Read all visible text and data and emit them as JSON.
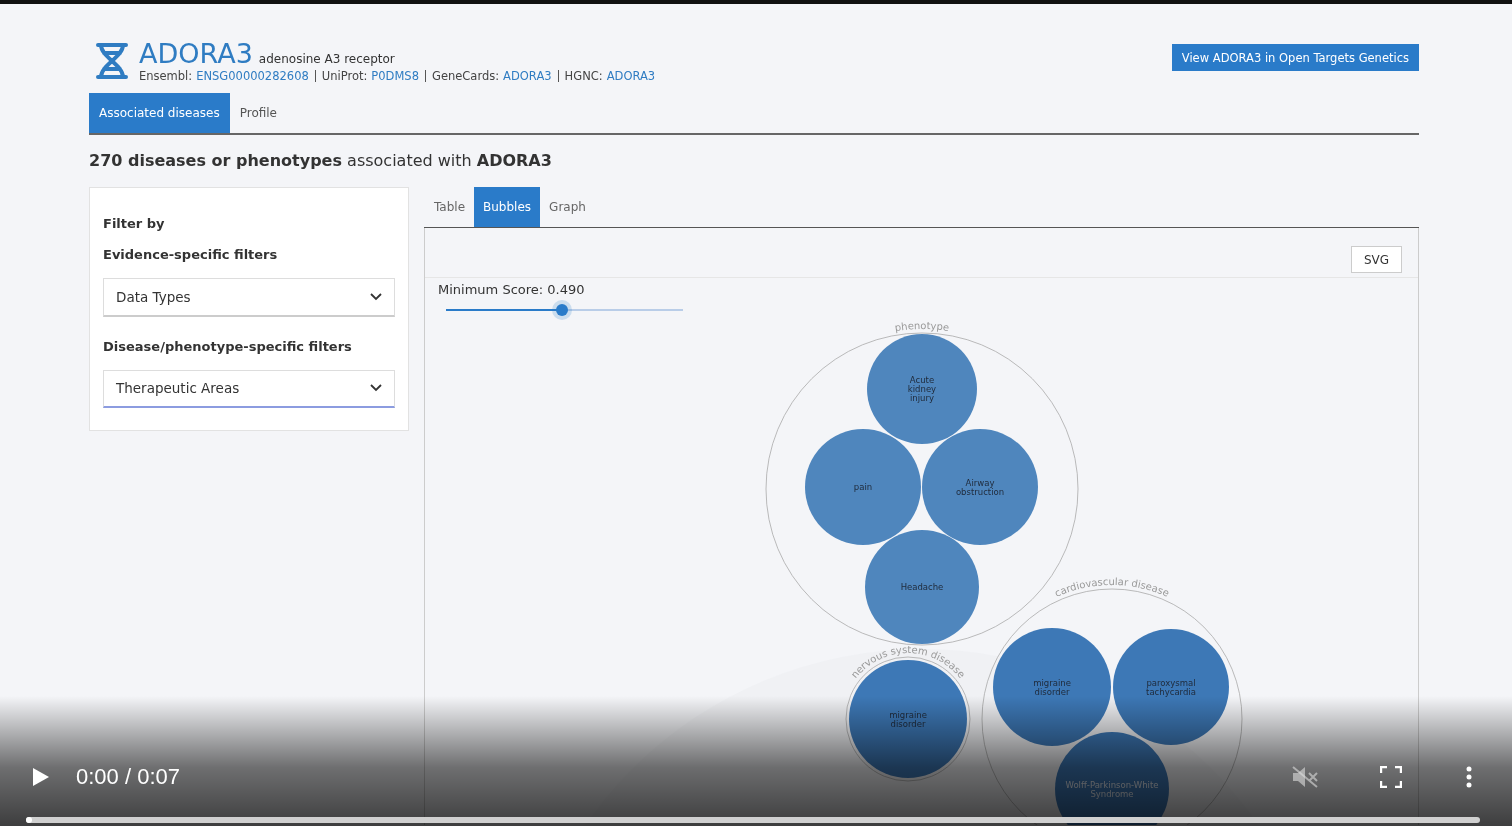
{
  "gene": {
    "symbol": "ADORA3",
    "name": "adenosine A3 receptor",
    "ids": [
      {
        "label": "Ensembl:",
        "value": "ENSG00000282608"
      },
      {
        "label": "UniProt:",
        "value": "P0DMS8"
      },
      {
        "label": "GeneCards:",
        "value": "ADORA3"
      },
      {
        "label": "HGNC:",
        "value": "ADORA3"
      }
    ]
  },
  "action_button": "View ADORA3 in Open Targets Genetics",
  "tabs": [
    {
      "label": "Associated diseases",
      "selected": true
    },
    {
      "label": "Profile",
      "selected": false
    }
  ],
  "heading": "**270 diseases or phenotypes** associated with **ADORA3**",
  "filters": {
    "title": "Filter by",
    "sections": [
      {
        "title": "Evidence-specific filters",
        "select": "Data Types",
        "focused": false
      },
      {
        "title": "Disease/phenotype-specific filters",
        "select": "Therapeutic Areas",
        "focused": true
      }
    ]
  },
  "view_tabs": [
    {
      "label": "Table",
      "selected": false
    },
    {
      "label": "Bubbles",
      "selected": true
    },
    {
      "label": "Graph",
      "selected": false
    }
  ],
  "export_button": "SVG",
  "slider": {
    "label": "Minimum Score: 0.490",
    "level": 0.49
  },
  "bubble_groups": [
    {
      "label": "phenotype",
      "bubbles": [
        [
          "Acute",
          "kidney",
          "injury"
        ],
        [
          "pain"
        ],
        [
          "Airway",
          "obstruction"
        ],
        [
          "Headache"
        ]
      ]
    },
    {
      "label": "nervous system disease",
      "bubbles": [
        [
          "migraine",
          "disorder"
        ]
      ]
    },
    {
      "label": "cardiovascular disease",
      "bubbles": [
        [
          "migraine",
          "disorder"
        ],
        [
          "paroxysmal",
          "tachycardia"
        ],
        [
          "Wolff-Parkinson-White",
          "Syndrome"
        ]
      ]
    }
  ],
  "player": {
    "time": "0:00 / 0:07",
    "level": 0,
    "muted": true
  }
}
